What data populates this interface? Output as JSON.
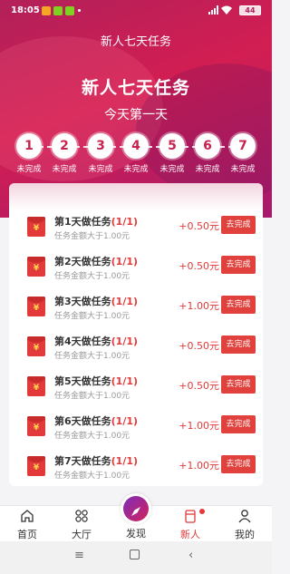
{
  "status": {
    "time": "18:05",
    "battery": "44"
  },
  "header": {
    "title": "新人七天任务"
  },
  "hero": {
    "title": "新人七天任务",
    "subtitle": "今天第一天"
  },
  "steps": [
    {
      "num": "1",
      "label": "未完成"
    },
    {
      "num": "2",
      "label": "未完成"
    },
    {
      "num": "3",
      "label": "未完成"
    },
    {
      "num": "4",
      "label": "未完成"
    },
    {
      "num": "5",
      "label": "未完成"
    },
    {
      "num": "6",
      "label": "未完成"
    },
    {
      "num": "7",
      "label": "未完成"
    }
  ],
  "tasks": [
    {
      "title": "第1天做任务",
      "progress": "(1/1)",
      "desc": "任务金额大于1.00元",
      "reward": "+0.50元",
      "button": "去完成"
    },
    {
      "title": "第2天做任务",
      "progress": "(1/1)",
      "desc": "任务金额大于1.00元",
      "reward": "+0.50元",
      "button": "去完成"
    },
    {
      "title": "第3天做任务",
      "progress": "(1/1)",
      "desc": "任务金额大于1.00元",
      "reward": "+1.00元",
      "button": "去完成"
    },
    {
      "title": "第4天做任务",
      "progress": "(1/1)",
      "desc": "任务金额大于1.00元",
      "reward": "+0.50元",
      "button": "去完成"
    },
    {
      "title": "第5天做任务",
      "progress": "(1/1)",
      "desc": "任务金额大于1.00元",
      "reward": "+0.50元",
      "button": "去完成"
    },
    {
      "title": "第6天做任务",
      "progress": "(1/1)",
      "desc": "任务金额大于1.00元",
      "reward": "+1.00元",
      "button": "去完成"
    },
    {
      "title": "第7天做任务",
      "progress": "(1/1)",
      "desc": "任务金额大于1.00元",
      "reward": "+1.00元",
      "button": "去完成"
    }
  ],
  "tabbar": [
    {
      "label": "首页",
      "icon": "home-icon"
    },
    {
      "label": "大厅",
      "icon": "grid-icon"
    },
    {
      "label": "发现",
      "icon": "compass-icon"
    },
    {
      "label": "新人",
      "icon": "gift-icon"
    },
    {
      "label": "我的",
      "icon": "user-icon"
    }
  ],
  "colors": {
    "brand": "#d21e52",
    "accent_red": "#e23a3a"
  }
}
